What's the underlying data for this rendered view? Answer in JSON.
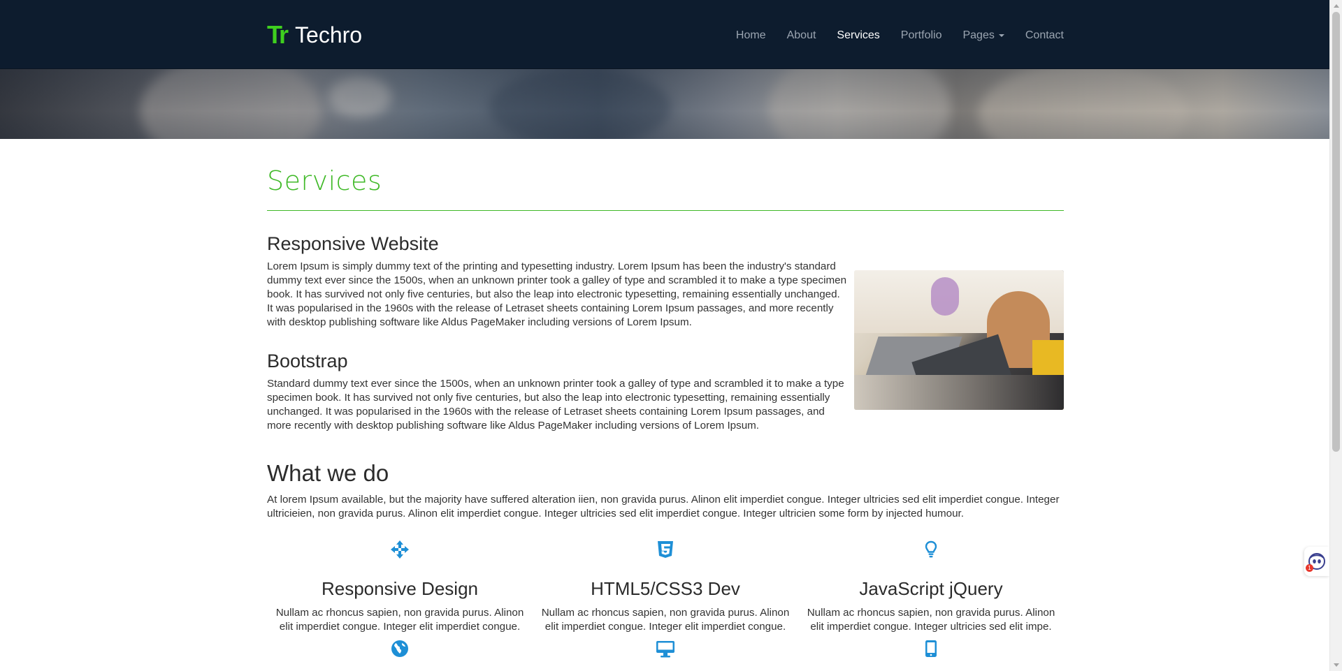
{
  "navbar": {
    "brand_logo": "Tr",
    "brand_name": "Techro",
    "links": [
      {
        "label": "Home"
      },
      {
        "label": "About"
      },
      {
        "label": "Services"
      },
      {
        "label": "Portfolio"
      },
      {
        "label": "Pages"
      },
      {
        "label": "Contact"
      }
    ],
    "active": "Services"
  },
  "page": {
    "title": "Services"
  },
  "services": [
    {
      "heading": "Responsive Website",
      "text": "Lorem Ipsum is simply dummy text of the printing and typesetting industry. Lorem Ipsum has been the industry's standard dummy text ever since the 1500s, when an unknown printer took a galley of type and scrambled it to make a type specimen book. It has survived not only five centuries, but also the leap into electronic typesetting, remaining essentially unchanged. It was popularised in the 1960s with the release of Letraset sheets containing Lorem Ipsum passages, and more recently with desktop publishing software like Aldus PageMaker including versions of Lorem Ipsum."
    },
    {
      "heading": "Bootstrap",
      "text": "Standard dummy text ever since the 1500s, when an unknown printer took a galley of type and scrambled it to make a type specimen book. It has survived not only five centuries, but also the leap into electronic typesetting, remaining essentially unchanged. It was popularised in the 1960s with the release of Letraset sheets containing Lorem Ipsum passages, and more recently with desktop publishing software like Aldus PageMaker including versions of Lorem Ipsum."
    }
  ],
  "what_we_do": {
    "heading": "What we do",
    "text": "At lorem Ipsum available, but the majority have suffered alteration iien, non gravida purus. Alinon elit imperdiet congue. Integer ultricies sed elit imperdiet congue. Integer ultricieien, non gravida purus. Alinon elit imperdiet congue. Integer ultricies sed elit imperdiet congue. Integer ultricien some form by injected humour.",
    "features": [
      {
        "icon": "arrows-move-icon",
        "title": "Responsive Design",
        "text": "Nullam ac rhoncus sapien, non gravida purus. Alinon elit imperdiet congue. Integer elit imperdiet congue."
      },
      {
        "icon": "css3-icon",
        "title": "HTML5/CSS3 Dev",
        "text": "Nullam ac rhoncus sapien, non gravida purus. Alinon elit imperdiet congue. Integer elit imperdiet congue."
      },
      {
        "icon": "lightbulb-icon",
        "title": "JavaScript jQuery",
        "text": "Nullam ac rhoncus sapien, non gravida purus. Alinon elit imperdiet congue. Integer ultricies sed elit impe."
      }
    ],
    "features_row2_icons": [
      "globe-icon",
      "desktop-icon",
      "tablet-icon"
    ]
  },
  "assistant": {
    "badge": "1"
  },
  "colors": {
    "navbar_bg": "#0d1c2e",
    "accent_green": "#3fb927",
    "icon_blue": "#1e8fd6",
    "text": "#333333"
  }
}
